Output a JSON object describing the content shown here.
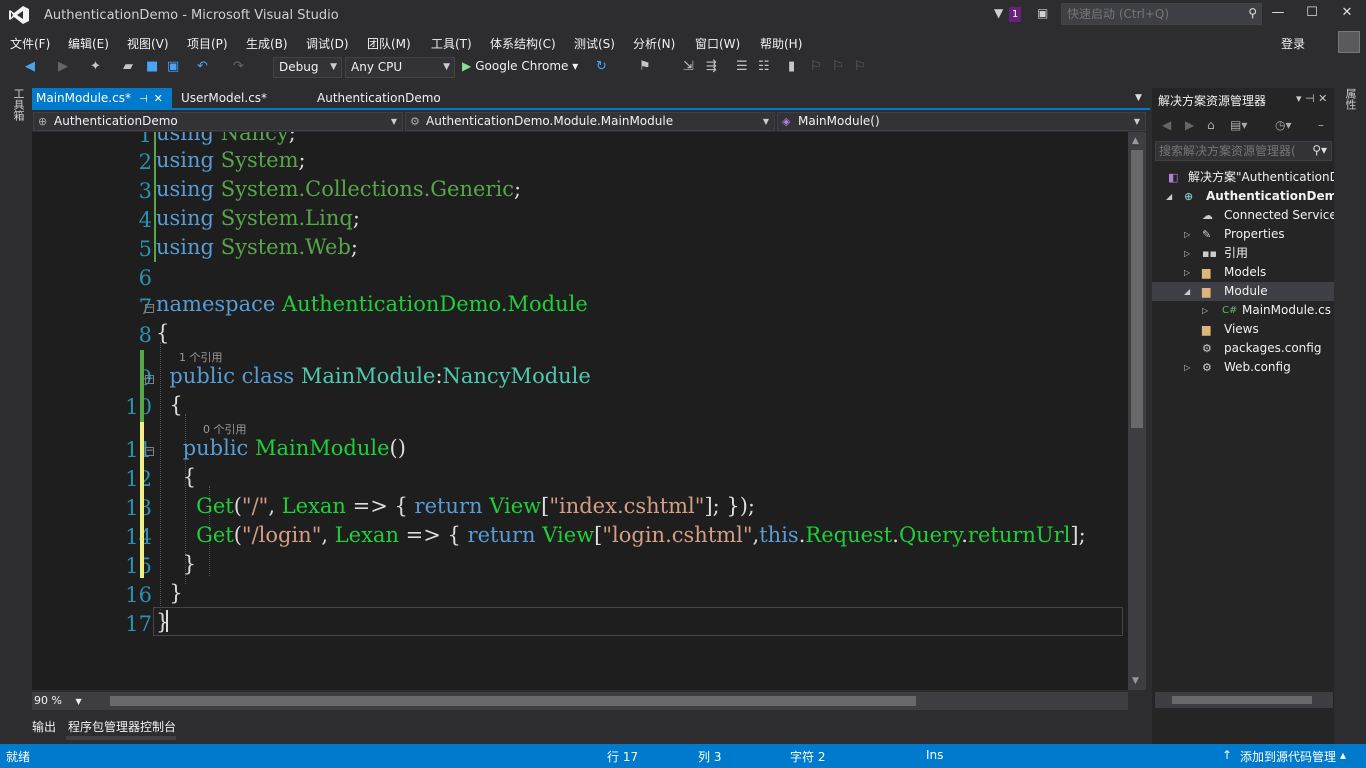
{
  "window": {
    "title": "AuthenticationDemo - Microsoft Visual Studio",
    "notification_count": "1",
    "quick_launch_placeholder": "快速启动 (Ctrl+Q)",
    "sign_in": "登录"
  },
  "menu": [
    "文件(F)",
    "编辑(E)",
    "视图(V)",
    "项目(P)",
    "生成(B)",
    "调试(D)",
    "团队(M)",
    "工具(T)",
    "体系结构(C)",
    "测试(S)",
    "分析(N)",
    "窗口(W)",
    "帮助(H)"
  ],
  "toolbar": {
    "config": "Debug",
    "platform": "Any CPU",
    "run_target": "Google Chrome"
  },
  "side_tabs": {
    "toolbox": "工具箱",
    "properties": "属性"
  },
  "tabs": [
    {
      "label": "MainModule.cs*",
      "active": true
    },
    {
      "label": "UserModel.cs*",
      "active": false
    },
    {
      "label": "AuthenticationDemo",
      "active": false
    }
  ],
  "navbar": {
    "project": "AuthenticationDemo",
    "type": "AuthenticationDemo.Module.MainModule",
    "member": "MainModule()"
  },
  "editor": {
    "line_numbers": [
      "1",
      "2",
      "3",
      "4",
      "5",
      "6",
      "7",
      "8",
      "9",
      "10",
      "11",
      "12",
      "13",
      "14",
      "15",
      "16",
      "17"
    ],
    "codelens": {
      "class_refs": "1 个引用",
      "ctor_refs": "0 个引用"
    },
    "tokens": {
      "using": "using",
      "Nancy": "Nancy",
      "System": "System",
      "SystemCollectionsGeneric": "System.Collections.Generic",
      "SystemLinq": "System.Linq",
      "SystemWeb": "System.Web",
      "namespace": "namespace",
      "ns": "AuthenticationDemo.Module",
      "public": "public",
      "class": "class",
      "MainModule": "MainModule",
      "NancyModule": "NancyModule",
      "Get": "Get",
      "path_root": "\"/\"",
      "path_login": "\"/login\"",
      "Lexan": "Lexan",
      "return": "return",
      "View": "View",
      "index": "\"index.cshtml\"",
      "login": "\"login.cshtml\"",
      "this": "this",
      "Request": "Request",
      "Query": "Query",
      "returnUrl": "returnUrl"
    }
  },
  "zoom": "90 %",
  "bottom_tabs": [
    "输出",
    "程序包管理器控制台"
  ],
  "solution_explorer": {
    "title": "解决方案资源管理器",
    "search_placeholder": "搜索解决方案资源管理器(",
    "items": [
      {
        "label": "解决方案\"AuthenticationD",
        "icon": "solution-icon"
      },
      {
        "label": "AuthenticationDemo",
        "icon": "web-project-icon"
      },
      {
        "label": "Connected Services",
        "icon": "connected-services-icon"
      },
      {
        "label": "Properties",
        "icon": "wrench-icon"
      },
      {
        "label": "引用",
        "icon": "references-icon"
      },
      {
        "label": "Models",
        "icon": "folder-icon"
      },
      {
        "label": "Module",
        "icon": "folder-open-icon"
      },
      {
        "label": "MainModule.cs",
        "icon": "csharp-file-icon"
      },
      {
        "label": "Views",
        "icon": "folder-icon"
      },
      {
        "label": "packages.config",
        "icon": "config-file-icon"
      },
      {
        "label": "Web.config",
        "icon": "config-file-icon"
      }
    ]
  },
  "status": {
    "ready": "就绪",
    "row": "行 17",
    "col": "列 3",
    "char": "字符 2",
    "mode": "Ins",
    "source_control": "添加到源代码管理"
  },
  "colors": {
    "accent": "#007acc",
    "keyword": "#569cd6",
    "type": "#4ec9b0",
    "green_identifier": "#1fcf38",
    "string": "#d69d85",
    "line_number": "#2b91af"
  }
}
